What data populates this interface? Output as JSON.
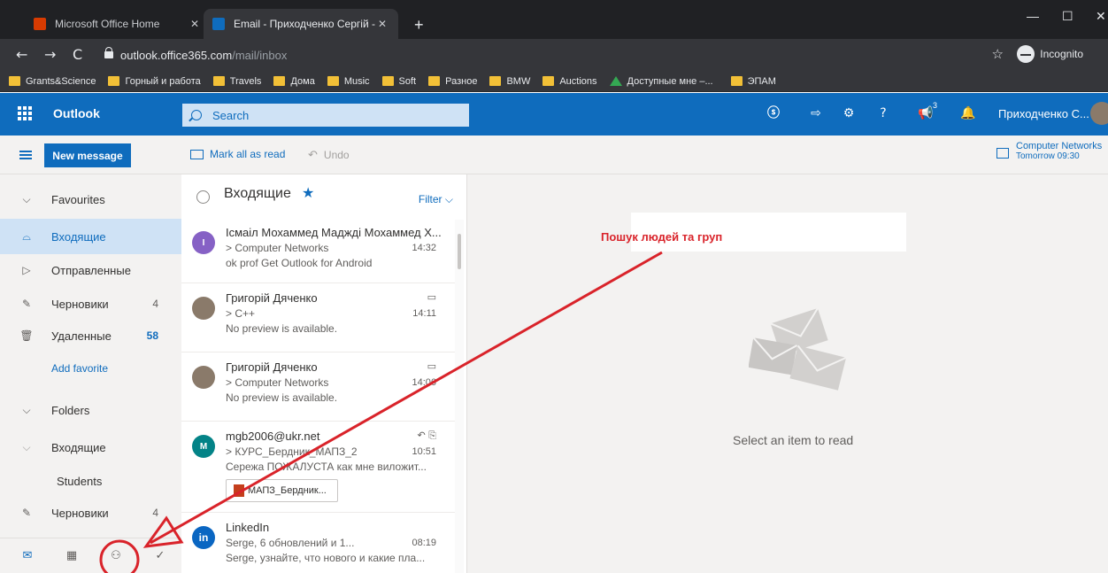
{
  "browser": {
    "tabs": [
      {
        "title": "Microsoft Office Home",
        "favicon_color": "#d83b01"
      },
      {
        "title": "Email - Приходченко Сергій - О",
        "favicon_color": "#0f6cbd"
      }
    ],
    "new_tab": "+",
    "url_host": "outlook.office365.com",
    "url_path": "/mail/inbox",
    "incognito_label": "Incognito",
    "bookmarks": [
      "Grants&Science",
      "Горный и работа",
      "Travels",
      "Дома",
      "Music",
      "Soft",
      "Разное",
      "BMW",
      "Auctions",
      "Доступные мне –...",
      "ЭПАМ"
    ]
  },
  "header": {
    "app_name": "Outlook",
    "search_placeholder": "Search",
    "notifications_count": "3",
    "user_name": "Приходченко С...",
    "accent": "#0f6cbd"
  },
  "commandbar": {
    "new_message": "New message",
    "mark_all_read": "Mark all as read",
    "undo": "Undo",
    "event_title": "Computer Networks",
    "event_time": "Tomorrow 09:30"
  },
  "nav": {
    "favourites": "Favourites",
    "items": [
      {
        "label": "Входящие",
        "count": ""
      },
      {
        "label": "Отправленные",
        "count": ""
      },
      {
        "label": "Черновики",
        "count": "4"
      },
      {
        "label": "Удаленные",
        "count": "58"
      }
    ],
    "add_favorite": "Add favorite",
    "folders": "Folders",
    "folder_items": [
      {
        "label": "Входящие",
        "count": ""
      },
      {
        "label": "Students",
        "count": ""
      },
      {
        "label": "Черновики",
        "count": "4"
      }
    ]
  },
  "list": {
    "title": "Входящие",
    "filter": "Filter",
    "messages": [
      {
        "initial": "I",
        "avatar_color": "#8661c5",
        "from": "Ісмаіл Мохаммед Маджді Мохаммед Х...",
        "subject": "> Computer Networks",
        "time": "14:32",
        "preview": "ok prof Get Outlook for Android"
      },
      {
        "initial": "",
        "avatar_color": "#8a7a6a",
        "from": "Григорій Дяченко",
        "subject": "> C++",
        "time": "14:11",
        "preview": "No preview is available."
      },
      {
        "initial": "",
        "avatar_color": "#8a7a6a",
        "from": "Григорій Дяченко",
        "subject": "> Computer Networks",
        "time": "14:06",
        "preview": "No preview is available."
      },
      {
        "initial": "M",
        "avatar_color": "#038387",
        "from": "mgb2006@ukr.net",
        "subject": "> КУРС_Бердник_МАПЗ_2",
        "time": "10:51",
        "preview": "Сережа ПОЖАЛУСТА как мне виложит...",
        "attachment": "МАПЗ_Бердник..."
      },
      {
        "initial": "in",
        "avatar_color": "#0a66c2",
        "from": "LinkedIn",
        "subject": "Serge, 6 обновлений и 1...",
        "time": "08:19",
        "preview": "Serge, узнайте, что нового и какие пла..."
      }
    ]
  },
  "reading": {
    "annotation": "Пошук людей та груп",
    "annotation_color": "#d9232a",
    "empty_text": "Select an item to read"
  }
}
